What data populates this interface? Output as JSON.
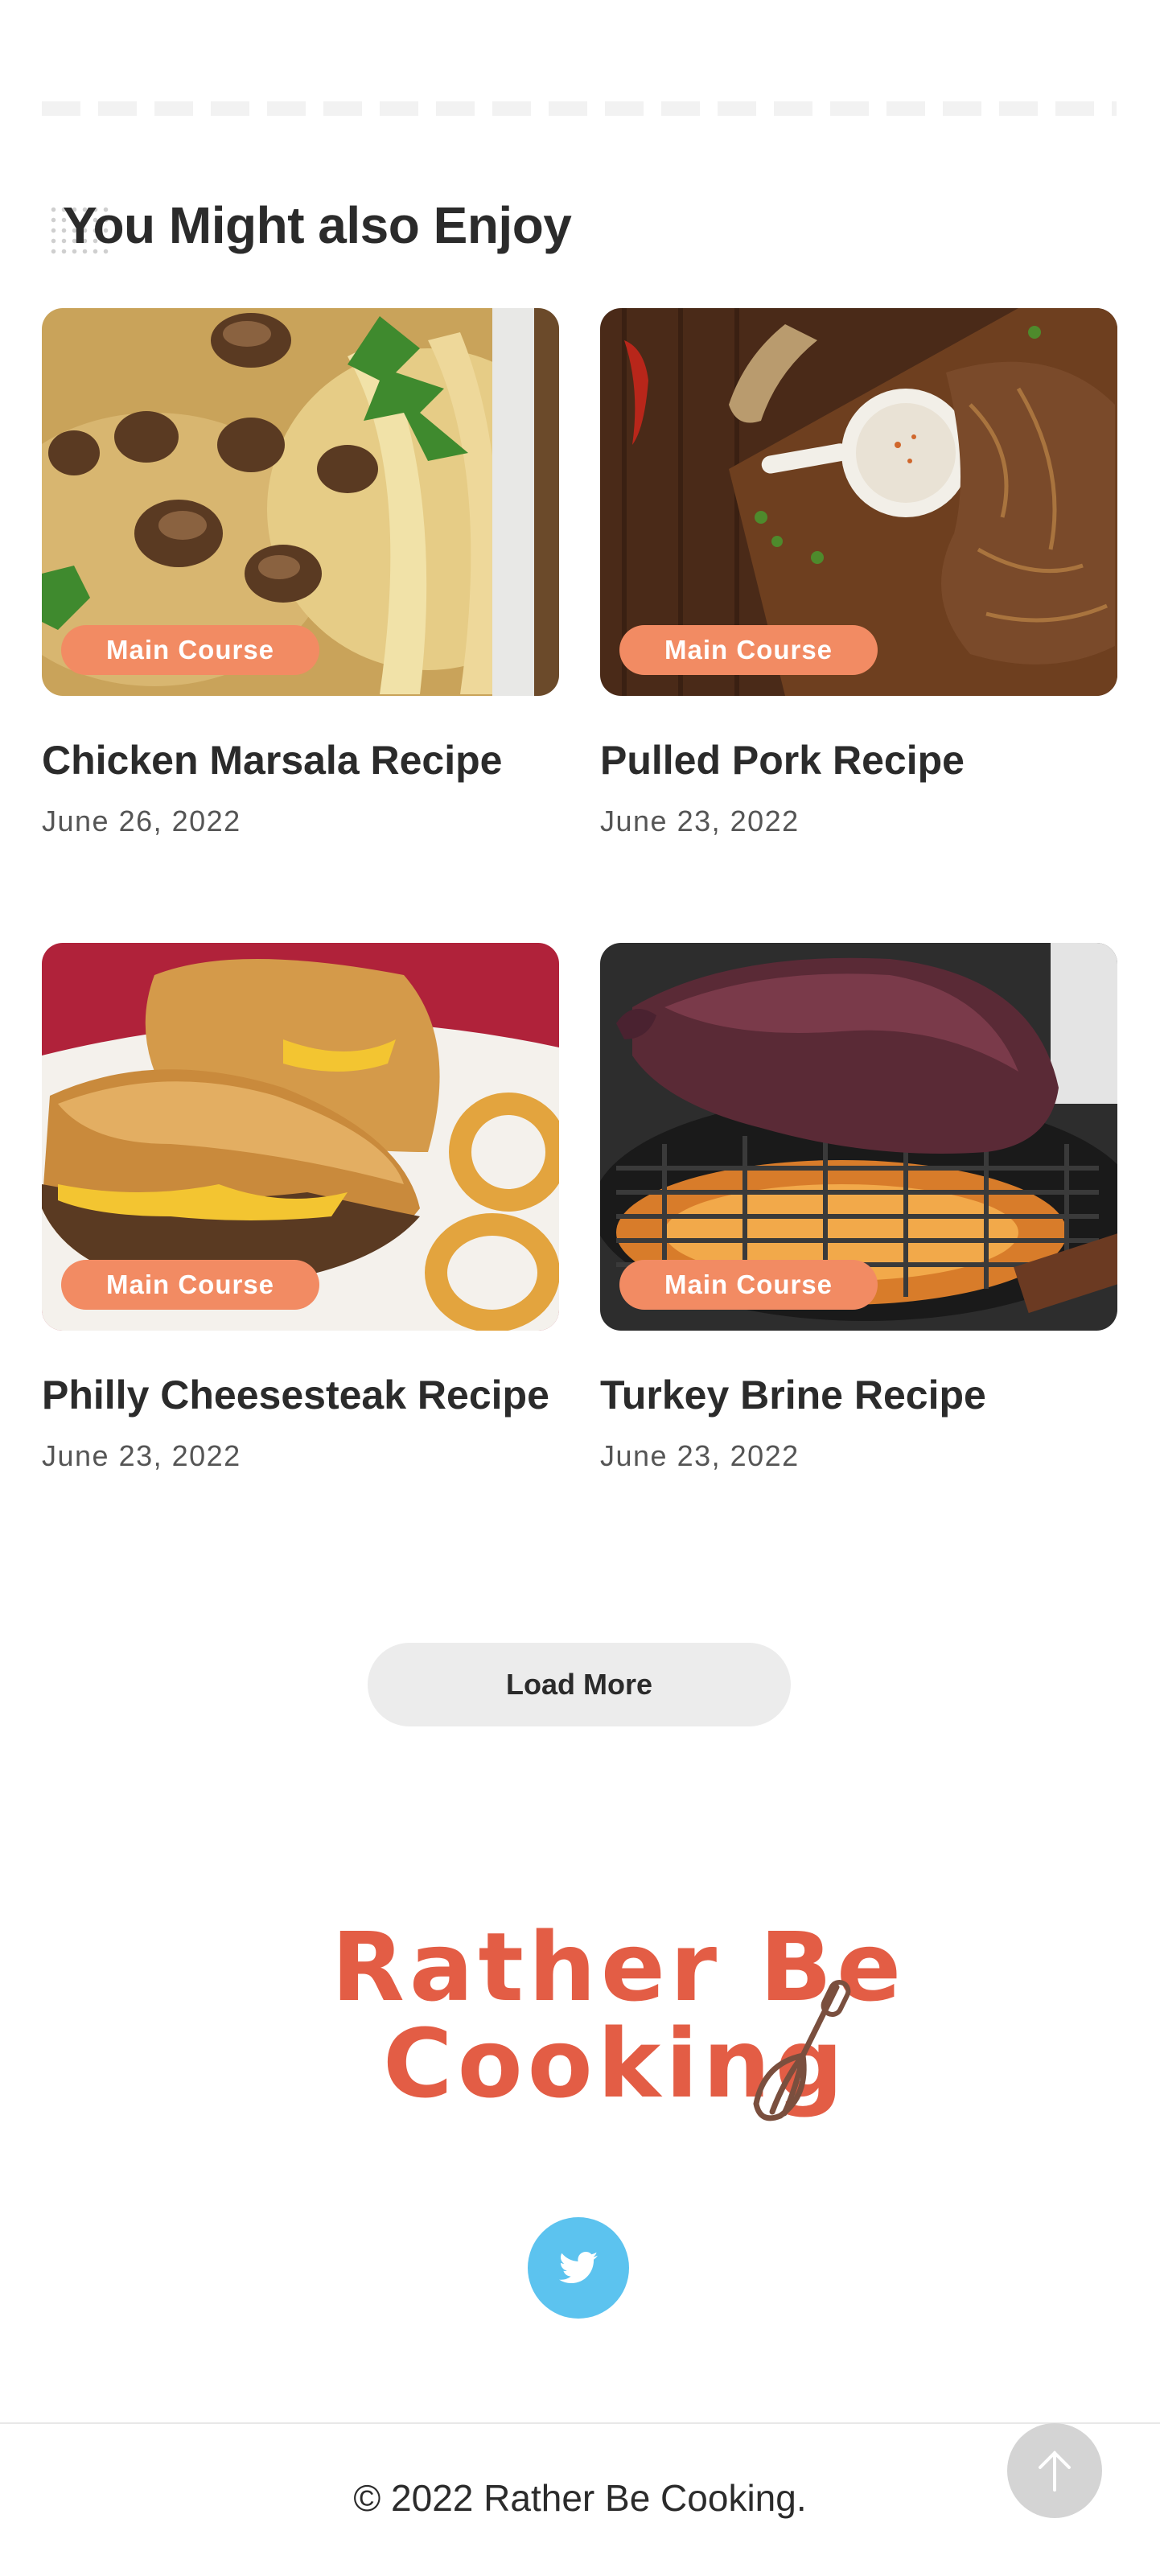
{
  "section": {
    "title": "You Might also Enjoy"
  },
  "recipes": [
    {
      "category": "Main Course",
      "title": "Chicken Marsala Recipe",
      "date": "June 26, 2022",
      "image": "chicken-marsala-photo"
    },
    {
      "category": "Main Course",
      "title": "Pulled Pork Recipe",
      "date": "June 23, 2022",
      "image": "pulled-pork-photo"
    },
    {
      "category": "Main Course",
      "title": "Philly Cheesesteak Recipe",
      "date": "June 23, 2022",
      "image": "philly-cheesesteak-photo"
    },
    {
      "category": "Main Course",
      "title": "Turkey Brine Recipe",
      "date": "June 23, 2022",
      "image": "smoked-turkey-photo"
    }
  ],
  "load_more": {
    "label": "Load More"
  },
  "brand": {
    "line1": "Rather Be",
    "line2": "Cooking",
    "icon": "whisk-icon"
  },
  "social": {
    "icon": "twitter-icon"
  },
  "footer": {
    "copyright": "© 2022 Rather Be Cooking."
  },
  "scroll_top": {
    "icon": "arrow-up-icon"
  },
  "colors": {
    "accent": "#f28b63",
    "brand": "#e35d45",
    "twitter": "#5cc3ef",
    "text": "#2b2b2b",
    "muted": "#555555"
  }
}
